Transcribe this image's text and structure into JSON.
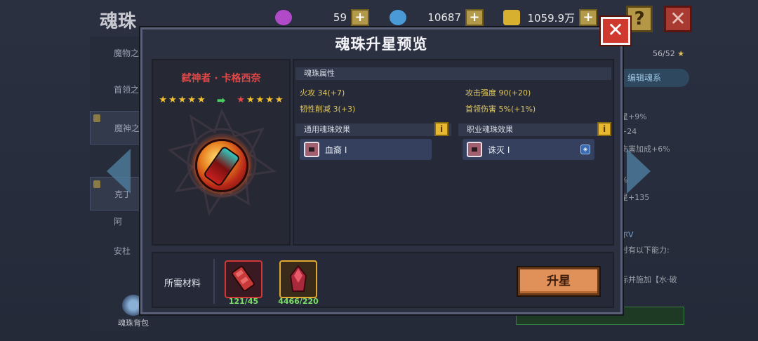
{
  "background": {
    "title": "魂珠",
    "currencies": [
      {
        "icon": "purple-gem-icon",
        "value": "59",
        "color": "#b04ac8"
      },
      {
        "icon": "blue-gem-icon",
        "value": "10687",
        "color": "#4a9ad8"
      },
      {
        "icon": "gold-coin-icon",
        "value": "1059.9万",
        "color": "#d8b030"
      }
    ],
    "help_label": "?",
    "close_label": "✕",
    "sidebar_items": [
      "魔物之",
      "首领之",
      "魔神之",
      "克丁",
      "阿",
      "安杜"
    ],
    "bag_label": "魂珠背包",
    "count": "56/52",
    "edit_label": "编辑魂系",
    "stats": [
      "星+9%",
      "+24",
      "伤害加成+6%",
      "%",
      "星+135"
    ],
    "right_texts": [
      "尔V",
      "时有以下能力:",
      "标并施加【水·破"
    ]
  },
  "modal": {
    "title": "魂珠升星预览",
    "close_label": "✕",
    "hero": {
      "name": "弑神者 · 卡格西奈",
      "stars_current": 5,
      "stars_next": 5,
      "arrow": "➡"
    },
    "attributes": {
      "header": "魂珠属性",
      "items": [
        {
          "name": "火攻",
          "value": "34",
          "inc": "(+7)"
        },
        {
          "name": "攻击强度",
          "value": "90",
          "inc": "(+20)"
        },
        {
          "name": "韧性削减",
          "value": "3",
          "inc": "(+3)"
        },
        {
          "name": "首领伤害",
          "value": "5%",
          "inc": "(+1%)"
        }
      ]
    },
    "general_effect": {
      "header": "通用魂珠效果",
      "info": "i",
      "label": "血裔 Ⅰ"
    },
    "class_effect": {
      "header": "职业魂珠效果",
      "info": "i",
      "label": "诛灭 Ⅰ"
    },
    "materials": {
      "label": "所需材料",
      "items": [
        {
          "icon": "red-crystal-shard-icon",
          "count": "121/45"
        },
        {
          "icon": "red-stone-icon",
          "count": "4466/220"
        }
      ]
    },
    "upgrade_label": "升星"
  }
}
